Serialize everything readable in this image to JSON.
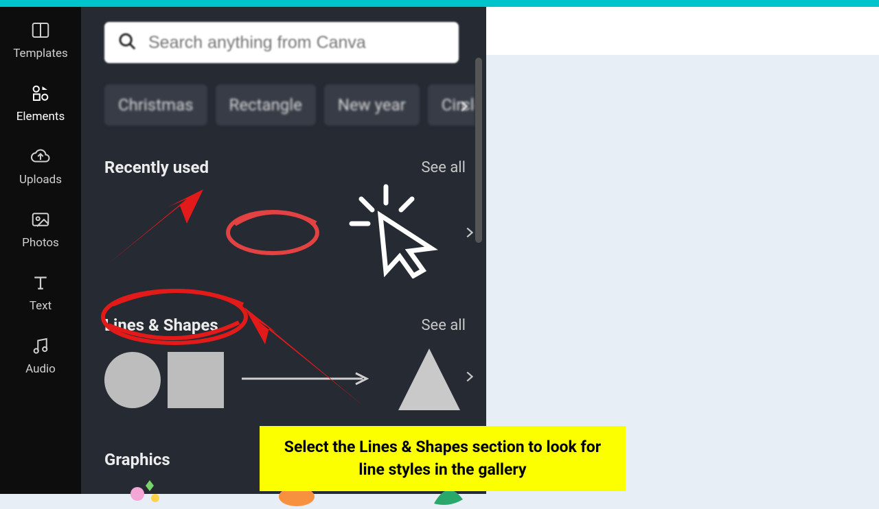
{
  "sidebar": {
    "items": [
      {
        "label": "Templates"
      },
      {
        "label": "Elements"
      },
      {
        "label": "Uploads"
      },
      {
        "label": "Photos"
      },
      {
        "label": "Text"
      },
      {
        "label": "Audio"
      }
    ]
  },
  "search": {
    "placeholder": "Search anything from Canva"
  },
  "chips": [
    "Christmas",
    "Rectangle",
    "New year",
    "Circle"
  ],
  "sections": {
    "recent": {
      "title": "Recently used",
      "see_all": "See all"
    },
    "lines": {
      "title": "Lines & Shapes",
      "see_all": "See all"
    },
    "graphics": {
      "title": "Graphics"
    }
  },
  "callout": "Select the Lines & Shapes section to look for line styles in the gallery"
}
